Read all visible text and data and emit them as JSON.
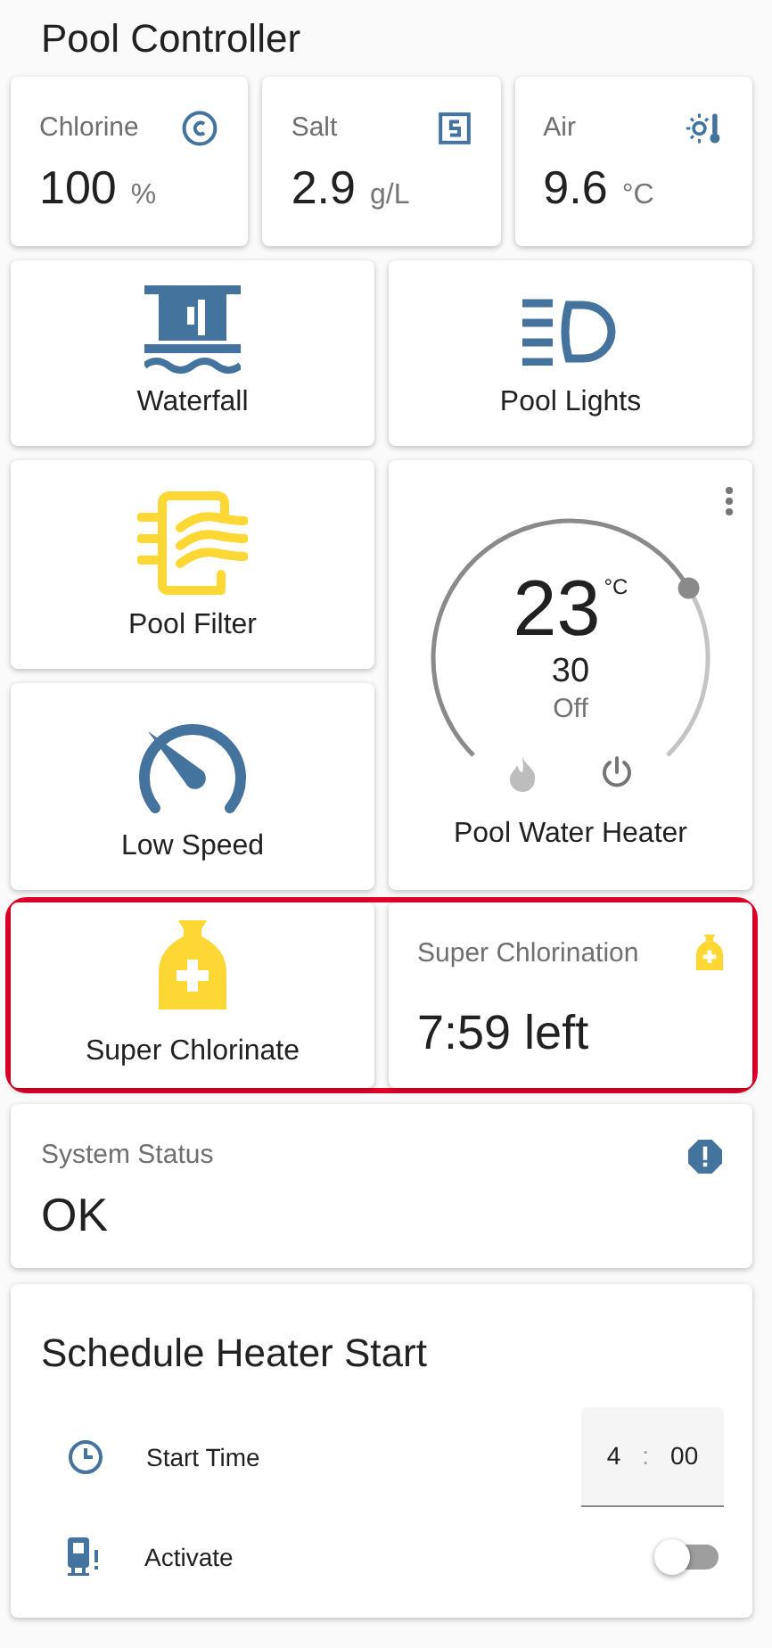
{
  "title": "Pool Controller",
  "sensors": [
    {
      "kind": "chlorine",
      "label": "Chlorine",
      "value": "100",
      "unit": "%"
    },
    {
      "kind": "salt",
      "label": "Salt",
      "value": "2.9",
      "unit": "g/L"
    },
    {
      "kind": "air",
      "label": "Air",
      "value": "9.6",
      "unit": "°C"
    }
  ],
  "tiles": [
    {
      "kind": "waterfall",
      "label": "Waterfall",
      "on": false
    },
    {
      "kind": "lights",
      "label": "Pool Lights",
      "on": false
    },
    {
      "kind": "filter",
      "label": "Pool Filter",
      "on": true
    },
    {
      "kind": "speed",
      "label": "Low Speed",
      "on": false
    }
  ],
  "heater": {
    "target": "23",
    "unit": "°C",
    "current": "30",
    "mode": "Off",
    "label": "Pool Water Heater"
  },
  "super_row": {
    "highlighted": true,
    "button": {
      "label": "Super Chlorinate",
      "on": true
    },
    "status": {
      "title": "Super Chlorination",
      "value": "7:59 left",
      "on": true
    }
  },
  "system_status": {
    "label": "System Status",
    "value": "OK"
  },
  "schedule": {
    "title": "Schedule Heater Start",
    "rows": [
      {
        "kind": "time",
        "label": "Start Time",
        "hours": "4",
        "separator": ":",
        "minutes": "00"
      },
      {
        "kind": "toggle",
        "label": "Activate",
        "on": false
      }
    ]
  }
}
